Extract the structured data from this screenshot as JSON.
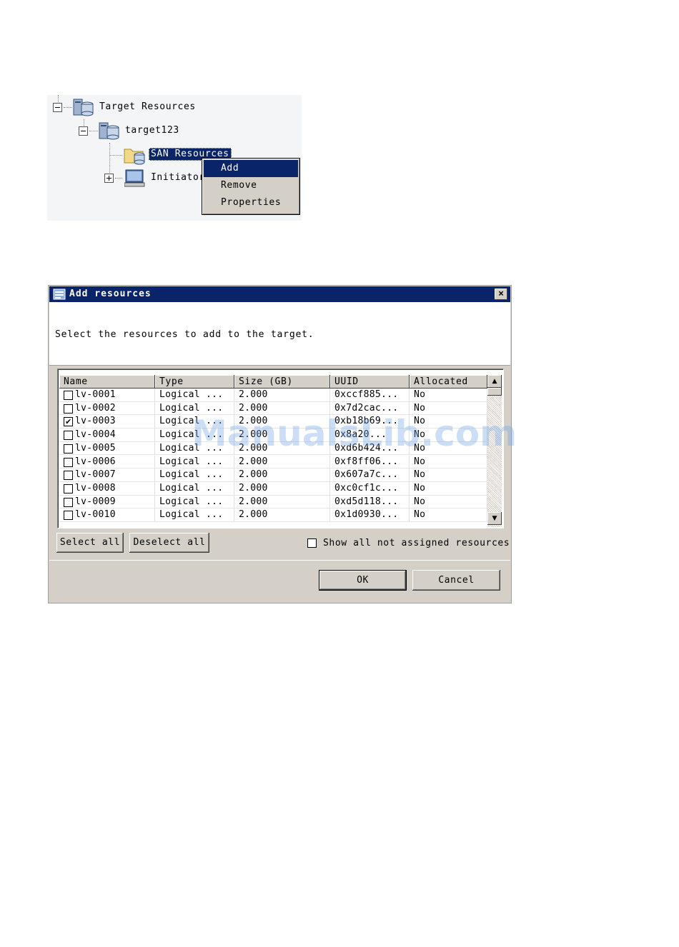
{
  "tree": {
    "root": "Target Resources",
    "target": "target123",
    "san": "SAN Resources",
    "initiators": "Initiator"
  },
  "context_menu": {
    "items": [
      "Add",
      "Remove",
      "Properties"
    ]
  },
  "dialog": {
    "title": "Add resources",
    "close_glyph": "×",
    "instruction": "Select the resources to add to the target.",
    "columns": [
      "Name",
      "Type",
      "Size (GB)",
      "UUID",
      "Allocated"
    ],
    "rows": [
      {
        "checked": false,
        "name": "lv-0001",
        "type": "Logical ...",
        "size": "2.000",
        "uuid": "0xccf885...",
        "allocated": "No"
      },
      {
        "checked": false,
        "name": "lv-0002",
        "type": "Logical ...",
        "size": "2.000",
        "uuid": "0x7d2cac...",
        "allocated": "No"
      },
      {
        "checked": true,
        "name": "lv-0003",
        "type": "Logical ...",
        "size": "2.000",
        "uuid": "0xb18b69...",
        "allocated": "No"
      },
      {
        "checked": false,
        "name": "lv-0004",
        "type": "Logical ...",
        "size": "2.000",
        "uuid": "0x8a20...",
        "allocated": "No"
      },
      {
        "checked": false,
        "name": "lv-0005",
        "type": "Logical ...",
        "size": "2.000",
        "uuid": "0xd6b424...",
        "allocated": "No"
      },
      {
        "checked": false,
        "name": "lv-0006",
        "type": "Logical ...",
        "size": "2.000",
        "uuid": "0xf8ff06...",
        "allocated": "No"
      },
      {
        "checked": false,
        "name": "lv-0007",
        "type": "Logical ...",
        "size": "2.000",
        "uuid": "0x607a7c...",
        "allocated": "No"
      },
      {
        "checked": false,
        "name": "lv-0008",
        "type": "Logical ...",
        "size": "2.000",
        "uuid": "0xc0cf1c...",
        "allocated": "No"
      },
      {
        "checked": false,
        "name": "lv-0009",
        "type": "Logical ...",
        "size": "2.000",
        "uuid": "0xd5d118...",
        "allocated": "No"
      },
      {
        "checked": false,
        "name": "lv-0010",
        "type": "Logical ...",
        "size": "2.000",
        "uuid": "0x1d0930...",
        "allocated": "No"
      }
    ],
    "scroll_up": "▲",
    "scroll_down": "▼",
    "select_all": "Select all",
    "deselect_all": "Deselect all",
    "show_all_label": "Show all not assigned resources",
    "show_all_checked": false,
    "ok": "OK",
    "cancel": "Cancel"
  },
  "watermark": "ManualsLib.com"
}
